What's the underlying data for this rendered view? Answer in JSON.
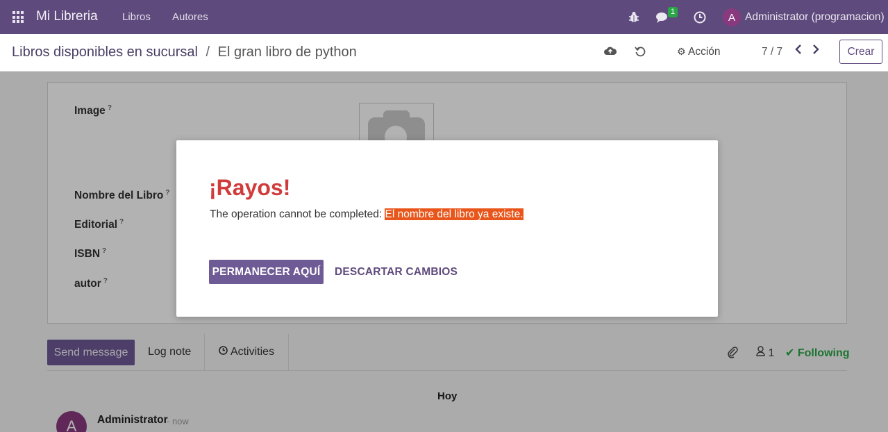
{
  "navbar": {
    "brand": "Mi Libreria",
    "menu": [
      "Libros",
      "Autores"
    ],
    "messages_badge": "1",
    "user_initial": "A",
    "user_name": "Administrator (programacion)"
  },
  "control_panel": {
    "breadcrumb_parent": "Libros disponibles en sucursal",
    "breadcrumb_separator": "/",
    "breadcrumb_current": "El gran libro de python",
    "action_label": "Acción",
    "pager": "7 / 7",
    "create_label": "Crear"
  },
  "form": {
    "fields": [
      {
        "label": "Image",
        "help": "?"
      },
      {
        "label": "Nombre del Libro",
        "help": "?"
      },
      {
        "label": "Editorial",
        "help": "?"
      },
      {
        "label": "ISBN",
        "help": "?"
      },
      {
        "label": "autor",
        "help": "?"
      }
    ]
  },
  "chatter": {
    "send_message": "Send message",
    "log_note": "Log note",
    "activities": "Activities",
    "followers_count": "1",
    "following": "Following",
    "date_separator": "Hoy",
    "message_author_initial": "A",
    "message_author": "Administrator",
    "message_time": "- now"
  },
  "dialog": {
    "title": "¡Rayos!",
    "body_prefix": "The operation cannot be completed: ",
    "body_highlight": "El nombre del libro ya existe.",
    "stay_button": "PERMANECER AQUÍ",
    "discard_button": "DESCARTAR CAMBIOS"
  },
  "colors": {
    "navbar": "#5e4a7c",
    "primary_button": "#6e5a95",
    "dialog_title": "#d03b3b",
    "highlight": "#e8561b",
    "following": "#28a745"
  }
}
